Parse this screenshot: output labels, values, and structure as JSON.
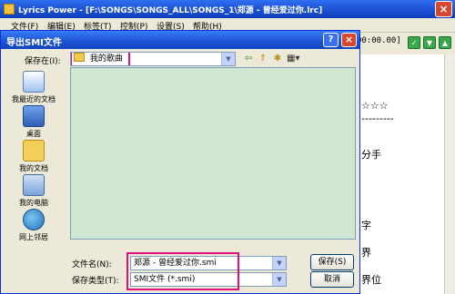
{
  "main_window": {
    "title": "Lyrics Power - [F:\\SONGS\\SONGS_ALL\\SONGS_1\\郑源 - 曾经爱过你.lrc]",
    "menu": [
      "文件(F)",
      "编辑(E)",
      "标签(T)",
      "控制(P)",
      "设置(S)",
      "帮助(H)"
    ],
    "timecode": "00:00.00]",
    "editor_lines": [
      "☆☆☆",
      "---------",
      "分手",
      "字",
      "界",
      "界位"
    ]
  },
  "dialog": {
    "title": "导出SMI文件",
    "save_in_label": "保存在(I):",
    "save_in_value": "我的歌曲",
    "places": [
      {
        "label": "我最近的文档",
        "icon": "recent-documents-icon"
      },
      {
        "label": "桌面",
        "icon": "desktop-icon"
      },
      {
        "label": "我的文档",
        "icon": "my-documents-icon"
      },
      {
        "label": "我的电脑",
        "icon": "my-computer-icon"
      },
      {
        "label": "网上邻居",
        "icon": "network-places-icon"
      }
    ],
    "filename_label": "文件名(N):",
    "filename_value": "郑源 - 曾经爱过你.smi",
    "filetype_label": "保存类型(T):",
    "filetype_value": "SMI文件 (*.smi)",
    "save_button": "保存(S)",
    "cancel_button": "取消"
  },
  "colors": {
    "highlight": "#e0127a",
    "file_area_bg": "#cfe6d3",
    "titlebar": "#1d55d6"
  }
}
